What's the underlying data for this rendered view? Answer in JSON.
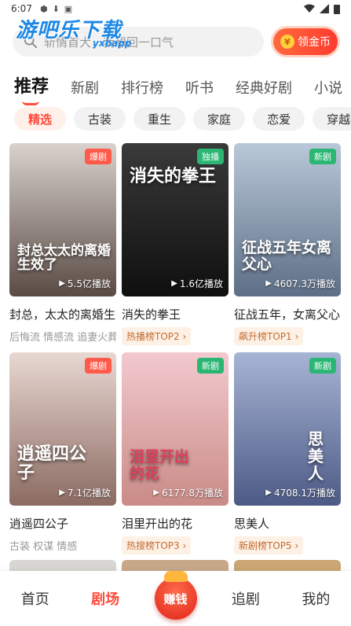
{
  "status_bar": {
    "time": "6:07"
  },
  "watermark": {
    "logo": "游吧乐下载",
    "small": "yxbapp"
  },
  "search": {
    "placeholder": "斩情首大，我想回一口气"
  },
  "coin_button": {
    "label": "领金币",
    "icon": "¥"
  },
  "main_tabs": [
    {
      "label": "推荐",
      "active": true
    },
    {
      "label": "新剧"
    },
    {
      "label": "排行榜"
    },
    {
      "label": "听书"
    },
    {
      "label": "经典好剧"
    },
    {
      "label": "小说"
    }
  ],
  "chips": [
    {
      "label": "精选",
      "active": true
    },
    {
      "label": "古装"
    },
    {
      "label": "重生"
    },
    {
      "label": "家庭"
    },
    {
      "label": "恋爱"
    },
    {
      "label": "穿越"
    }
  ],
  "cards": [
    {
      "title": "封总，太太的离婚生效了",
      "badge": "爆剧",
      "badge_type": "hot",
      "plays": "5.5亿播放",
      "poster_text": "封总太太的离婚生效了",
      "tags": "后悔流 情感流 追妻火葬场",
      "colors": [
        "#d9d2cc",
        "#5a4a44"
      ]
    },
    {
      "title": "消失的拳王",
      "badge": "独播",
      "badge_type": "exclusive",
      "plays": "1.6亿播放",
      "poster_text": "消失的拳王",
      "rank": "热播榜TOP2",
      "colors": [
        "#3a3a3a",
        "#0f0f0f"
      ]
    },
    {
      "title": "征战五年，女离父心",
      "badge": "新剧",
      "badge_type": "new",
      "plays": "4607.3万播放",
      "poster_text": "征战五年女离父心",
      "rank": "飙升榜TOP1",
      "colors": [
        "#b9c8d8",
        "#5d6f86"
      ]
    },
    {
      "title": "逍遥四公子",
      "badge": "爆剧",
      "badge_type": "hot",
      "plays": "7.1亿播放",
      "poster_text": "逍遥四公子",
      "tags": "古装 权谋 情感",
      "colors": [
        "#e8d8d2",
        "#8b6b62"
      ]
    },
    {
      "title": "泪里开出的花",
      "badge": "新剧",
      "badge_type": "new",
      "plays": "6177.8万播放",
      "poster_text": "泪里开出的花",
      "rank": "热搜榜TOP3",
      "colors": [
        "#f2c9cf",
        "#c98b86"
      ]
    },
    {
      "title": "思美人",
      "badge": "新剧",
      "badge_type": "new",
      "plays": "4708.1万播放",
      "poster_text": "思美人",
      "rank": "新剧榜TOP5",
      "colors": [
        "#a7b4d4",
        "#4d5a86"
      ]
    }
  ],
  "bottom_nav": {
    "items": [
      {
        "label": "首页"
      },
      {
        "label": "剧场",
        "active": true
      },
      {
        "label": "赚钱",
        "center": true
      },
      {
        "label": "追剧"
      },
      {
        "label": "我的"
      }
    ]
  },
  "colors": {
    "accent": "#ff4b3a",
    "chip_bg": "#f2f2f2",
    "rank_bg": "#fdf1e6"
  }
}
